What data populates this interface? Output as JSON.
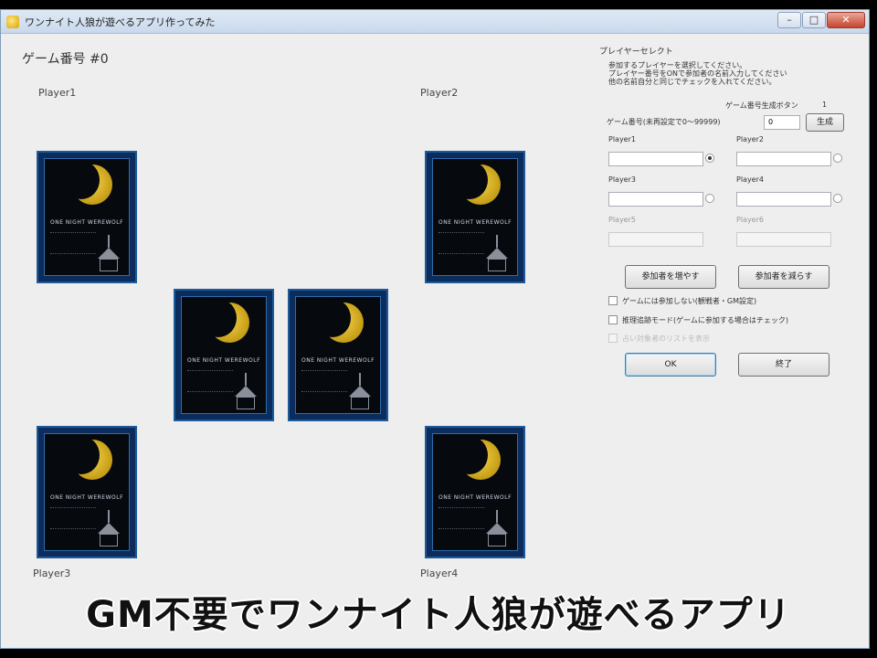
{
  "window": {
    "title": "ワンナイト人狼が遊べるアプリ作ってみた",
    "controls": {
      "minimize": "–",
      "maximize": "□",
      "close": "✕"
    }
  },
  "game": {
    "number_label": "ゲーム番号 #0"
  },
  "players": [
    {
      "label": "Player1"
    },
    {
      "label": "Player2"
    },
    {
      "label": "Player3"
    },
    {
      "label": "Player4"
    }
  ],
  "cards": {
    "title": "ONE NIGHT WEREWOLF",
    "count": 6
  },
  "panel": {
    "title": "プレイヤーセレクト",
    "instructions": [
      "参加するプレイヤーを選択してください。",
      "プレイヤー番号をONで参加者の名前入力してください",
      "他の名前自分と同じでチェックを入れてください。"
    ],
    "game_number_button_label": "ゲーム番号生成ボタン",
    "game_number_button_value": "1",
    "game_number_field_label": "ゲーム番号(未再設定で0〜99999)",
    "game_number_value": "0",
    "generate_button": "生成",
    "fields": [
      {
        "label": "Player1",
        "value": ""
      },
      {
        "label": "Player2",
        "value": ""
      },
      {
        "label": "Player3",
        "value": ""
      },
      {
        "label": "Player4",
        "value": ""
      },
      {
        "label": "Player5",
        "value": ""
      },
      {
        "label": "Player6",
        "value": ""
      }
    ],
    "add_button": "参加者を増やす",
    "remove_button": "参加者を減らす",
    "checkboxes": [
      {
        "label": "ゲームには参加しない(観戦者・GM設定)",
        "checked": false,
        "enabled": true
      },
      {
        "label": "推理追跡モード(ゲームに参加する場合はチェック)",
        "checked": false,
        "enabled": true
      },
      {
        "label": "占い対象者のリストを表示",
        "checked": false,
        "enabled": false
      }
    ],
    "ok_button": "OK",
    "exit_button": "終了"
  },
  "caption": "GM不要でワンナイト人狼が遊べるアプリ",
  "colors": {
    "card_border": "#1d5a99",
    "moon": "#f6d64a",
    "window_bg": "#eeeeee"
  }
}
